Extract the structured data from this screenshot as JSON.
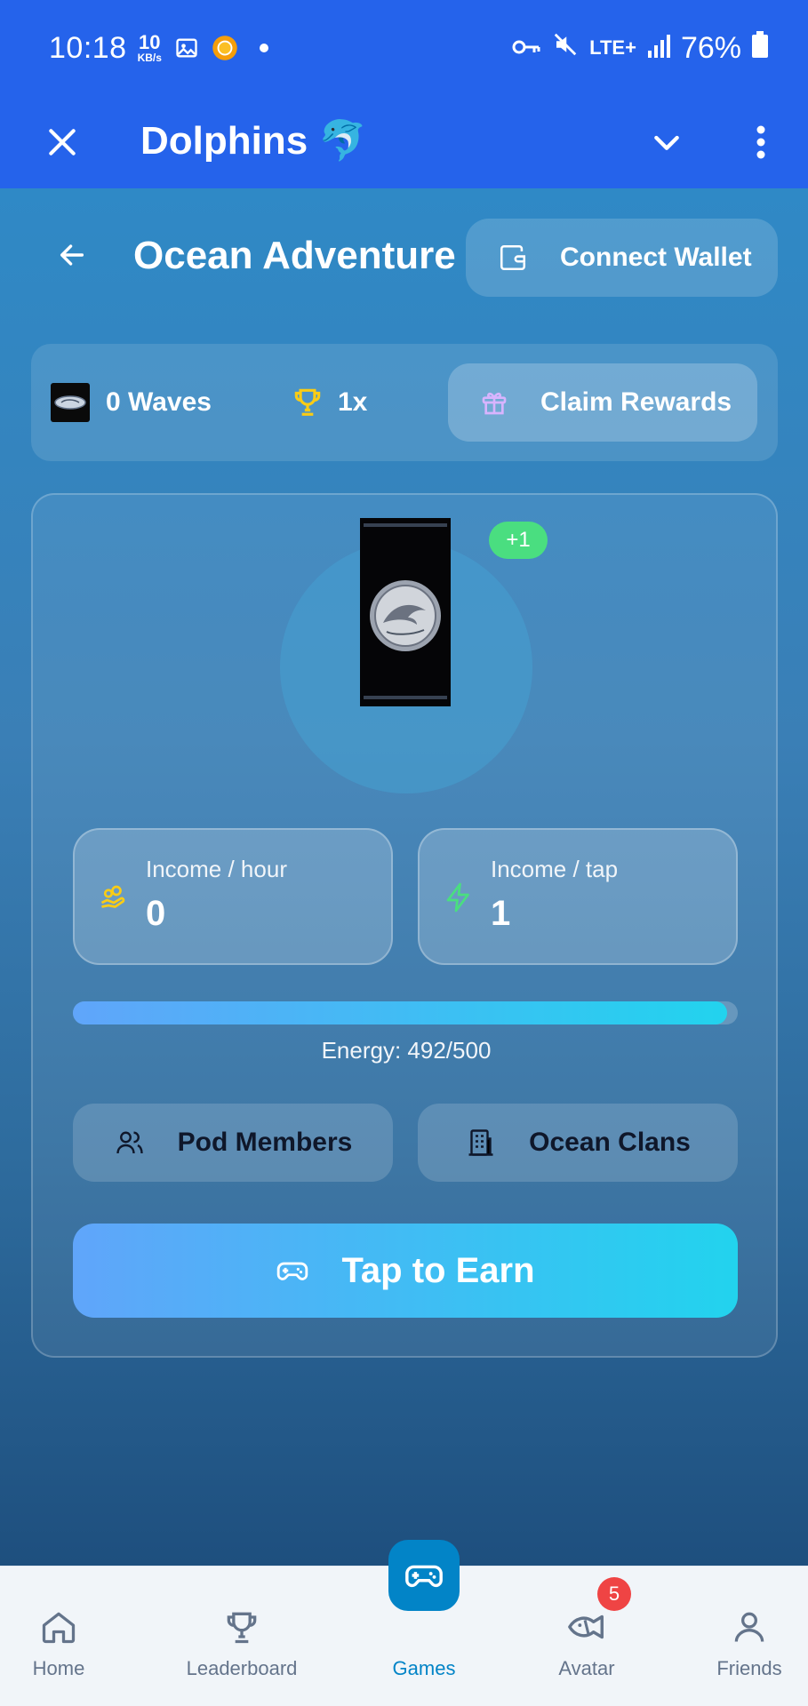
{
  "status_bar": {
    "time": "10:18",
    "net_speed_value": "10",
    "net_speed_unit": "KB/s",
    "network": "LTE+",
    "battery": "76%"
  },
  "app_bar": {
    "title": "Dolphins 🐬"
  },
  "game": {
    "title": "Ocean Adventure",
    "connect_wallet_label": "Connect Wallet",
    "waves_label": "0 Waves",
    "multiplier_label": "1x",
    "claim_rewards_label": "Claim Rewards",
    "tap_popup": "+1",
    "income_hour": {
      "label": "Income / hour",
      "value": "0"
    },
    "income_tap": {
      "label": "Income / tap",
      "value": "1"
    },
    "energy": {
      "label": "Energy: 492/500",
      "current": 492,
      "max": 500
    },
    "pod_members_label": "Pod Members",
    "ocean_clans_label": "Ocean Clans",
    "tap_to_earn_label": "Tap to Earn"
  },
  "bottom_nav": {
    "items": [
      {
        "label": "Home",
        "icon": "home-icon",
        "active": false
      },
      {
        "label": "Leaderboard",
        "icon": "trophy-icon",
        "active": false
      },
      {
        "label": "Games",
        "icon": "gamepad-icon",
        "active": true
      },
      {
        "label": "Avatar",
        "icon": "fish-icon",
        "active": false,
        "badge": "5"
      },
      {
        "label": "Friends",
        "icon": "user-icon",
        "active": false
      }
    ]
  },
  "colors": {
    "app_bar": "#2563eb",
    "accent_active": "#0284c7",
    "badge": "#ef4444",
    "plus_badge": "#4ade80",
    "trophy": "#facc15",
    "gift": "#d8b4fe",
    "zap": "#4ade80"
  }
}
